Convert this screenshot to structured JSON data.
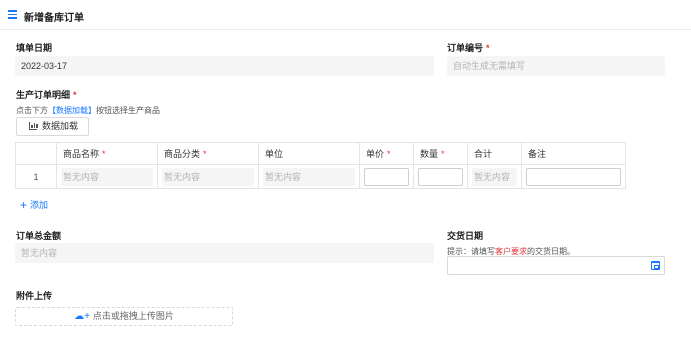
{
  "header": {
    "title": "新增备库订单",
    "menu_icon": "menu-icon"
  },
  "form": {
    "fill_date": {
      "label": "填单日期",
      "value": "2022-03-17"
    },
    "order_no": {
      "label": "订单编号",
      "required_mark": "*",
      "placeholder": "自动生成无需填写"
    },
    "details": {
      "label": "生产订单明细",
      "required_mark": "*",
      "hint_prefix": "点击下方",
      "hint_link": "【数据加载】",
      "hint_suffix": "按钮选择生产商品",
      "load_button": "数据加载",
      "load_icon": "bar-chart-icon"
    },
    "table": {
      "columns": [
        {
          "label": "",
          "required": false
        },
        {
          "label": "商品名称",
          "required": true
        },
        {
          "label": "商品分类",
          "required": true
        },
        {
          "label": "单位",
          "required": false
        },
        {
          "label": "单价",
          "required": true
        },
        {
          "label": "数量",
          "required": true
        },
        {
          "label": "合计",
          "required": false
        },
        {
          "label": "备注",
          "required": false
        }
      ],
      "rows": [
        {
          "index": "1",
          "name": "暂无内容",
          "category": "暂无内容",
          "unit": "暂无内容",
          "price": "",
          "qty": "",
          "total": "暂无内容",
          "note": ""
        }
      ],
      "add_label": "添加"
    },
    "total_amount": {
      "label": "订单总金额",
      "placeholder": "暂无内容"
    },
    "delivery_date": {
      "label": "交货日期",
      "hint_prefix": "提示：请填写",
      "hint_red": "客户要求",
      "hint_suffix": "的交货日期。",
      "value": "",
      "icon": "calendar-icon"
    },
    "attachment": {
      "label": "附件上传",
      "upload_text": "点击或拖拽上传图片",
      "icon": "cloud-upload-icon"
    }
  },
  "colors": {
    "accent": "#1677ff",
    "required": "#e4393c"
  }
}
